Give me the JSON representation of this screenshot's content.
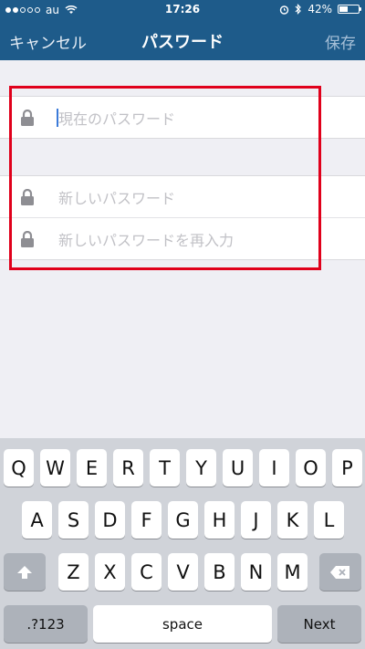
{
  "status_bar": {
    "carrier": "au",
    "time": "17:26",
    "battery": "42%"
  },
  "nav": {
    "cancel_label": "キャンセル",
    "title": "パスワード",
    "save_label": "保存"
  },
  "form": {
    "current_password_placeholder": "現在のパスワード",
    "new_password_placeholder": "新しいパスワード",
    "confirm_password_placeholder": "新しいパスワードを再入力"
  },
  "keyboard": {
    "row1": [
      "Q",
      "W",
      "E",
      "R",
      "T",
      "Y",
      "U",
      "I",
      "O",
      "P"
    ],
    "row2": [
      "A",
      "S",
      "D",
      "F",
      "G",
      "H",
      "J",
      "K",
      "L"
    ],
    "row3": [
      "Z",
      "X",
      "C",
      "V",
      "B",
      "N",
      "M"
    ],
    "numbers_label": ".?123",
    "space_label": "space",
    "next_label": "Next"
  }
}
